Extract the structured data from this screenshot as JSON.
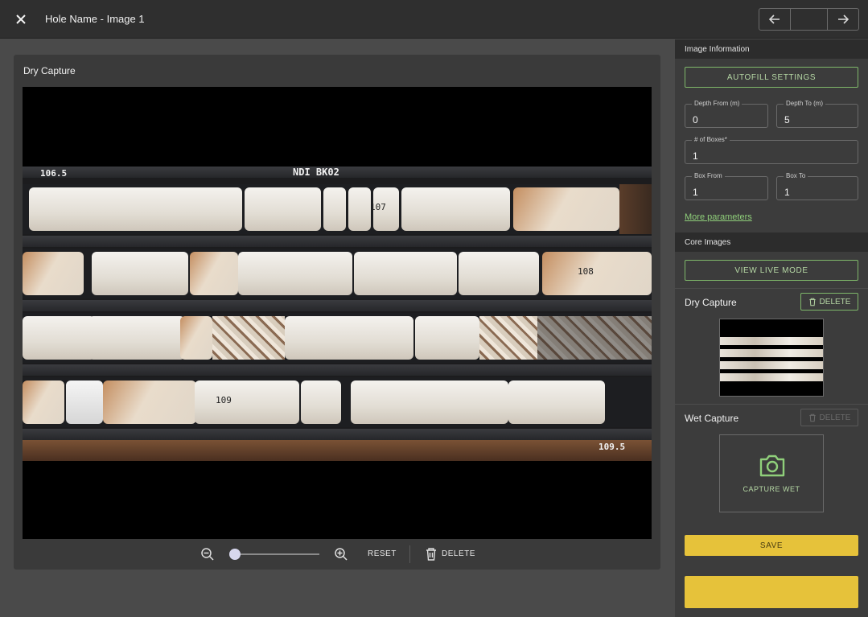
{
  "header": {
    "title": "Hole Name - Image 1"
  },
  "main": {
    "card_title": "Dry Capture",
    "photo_labels": {
      "depth_start": "106.5",
      "tray_id": "NDI BK02",
      "mark_107": "107",
      "mark_108": "108",
      "mark_109": "109",
      "depth_end": "109.5"
    },
    "controls": {
      "reset_label": "RESET",
      "delete_label": "DELETE"
    }
  },
  "side": {
    "image_info_heading": "Image Information",
    "autofill_label": "AUTOFILL SETTINGS",
    "fields": {
      "depth_from": {
        "label": "Depth From (m)",
        "value": "0"
      },
      "depth_to": {
        "label": "Depth To (m)",
        "value": "5"
      },
      "num_boxes": {
        "label": "# of Boxes*",
        "value": "1"
      },
      "box_from": {
        "label": "Box From",
        "value": "1"
      },
      "box_to": {
        "label": "Box To",
        "value": "1"
      }
    },
    "more_params_label": "More parameters",
    "core_images_heading": "Core Images",
    "live_mode_label": "VIEW LIVE MODE",
    "dry_capture_label": "Dry Capture",
    "wet_capture_label": "Wet Capture",
    "delete_label": "DELETE",
    "capture_wet_label": "CAPTURE WET",
    "save_label": "SAVE"
  },
  "colors": {
    "accent_green": "#7fb86a",
    "save_yellow": "#e6c23a"
  }
}
